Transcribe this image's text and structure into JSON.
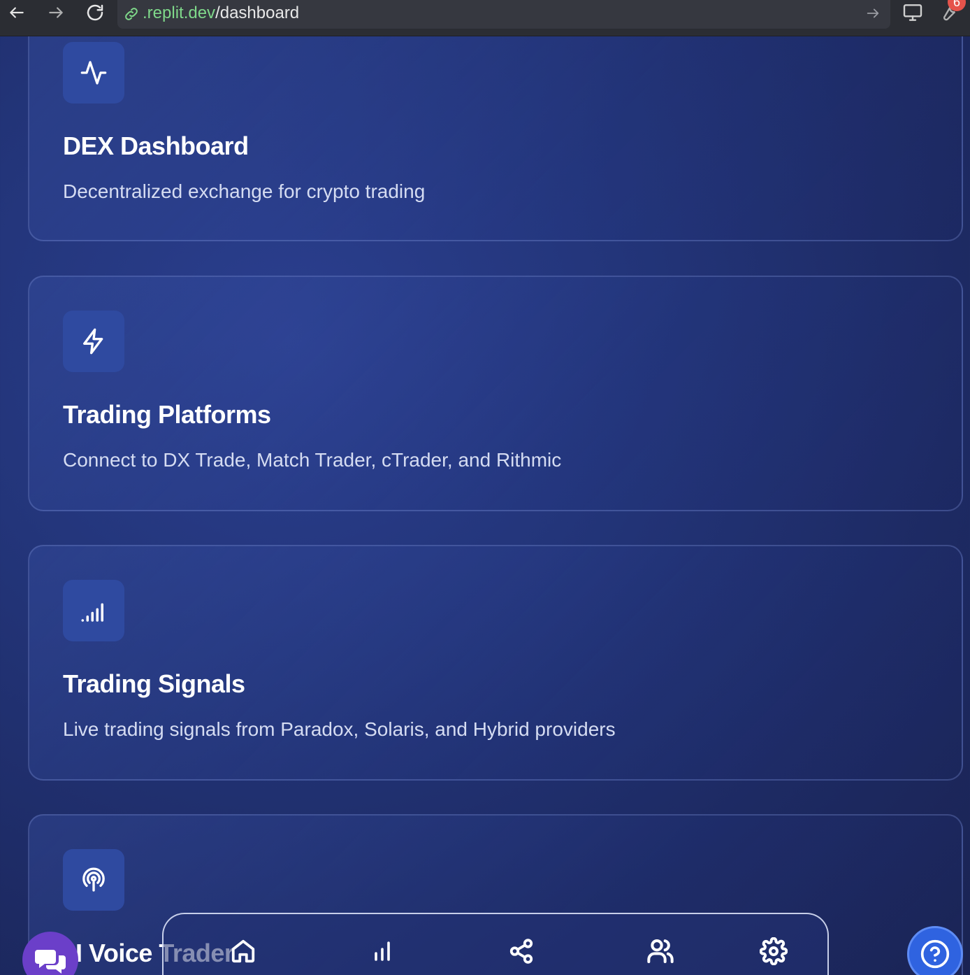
{
  "browser": {
    "url_host": ".replit.dev",
    "url_path": "/dashboard",
    "notification_count": "6"
  },
  "cards": [
    {
      "icon": "activity-icon",
      "title": "DEX Dashboard",
      "description": "Decentralized exchange for crypto trading"
    },
    {
      "icon": "zap-icon",
      "title": "Trading Platforms",
      "description": "Connect to DX Trade, Match Trader, cTrader, and Rithmic"
    },
    {
      "icon": "signal-icon",
      "title": "Trading Signals",
      "description": "Live trading signals from Paradox, Solaris, and Hybrid providers"
    },
    {
      "icon": "podcast-icon",
      "title": "AI Voice Trader",
      "title_visible": "I Voice Trader"
    }
  ],
  "bottom_nav": {
    "items": [
      "home-icon",
      "bar-chart-icon",
      "share-icon",
      "users-icon",
      "settings-icon"
    ]
  },
  "fabs": {
    "chat": "chat-icon",
    "help": "help-icon"
  },
  "colors": {
    "accent": "#2f4aa0",
    "url_host": "#7fd88a",
    "badge": "#e5534b",
    "chat_fab": "#6b3fc9",
    "help_fab": "#2f63e0"
  }
}
